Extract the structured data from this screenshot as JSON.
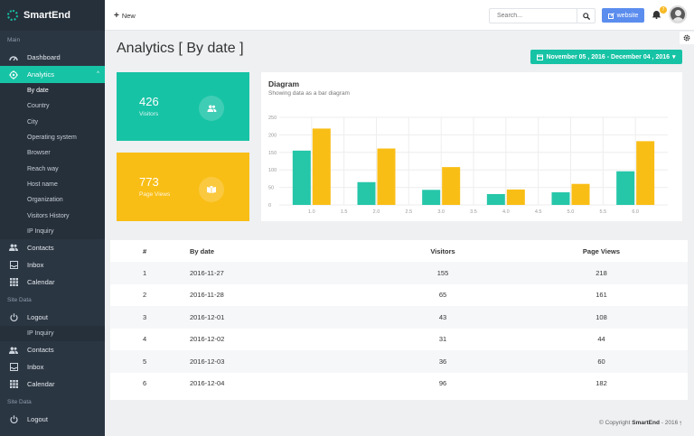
{
  "brand": {
    "name": "SmartEnd"
  },
  "sidebar": {
    "section_main": "Main",
    "dashboard": "Dashboard",
    "analytics": "Analytics",
    "sub_items": [
      "By date",
      "Country",
      "City",
      "Operating system",
      "Browser",
      "Reach way",
      "Host name",
      "Organization",
      "Visitors History",
      "IP Inquiry"
    ],
    "contacts": "Contacts",
    "inbox": "Inbox",
    "calendar": "Calendar",
    "section_site_data": "Site Data",
    "logout": "Logout",
    "ip_inquiry": "IP Inquiry",
    "contacts2": "Contacts",
    "inbox2": "Inbox",
    "calendar2": "Calendar",
    "section_site_data2": "Site Data",
    "logout2": "Logout"
  },
  "topbar": {
    "new_label": "New",
    "search_placeholder": "Search...",
    "website_label": "website",
    "notification_count": "7"
  },
  "page": {
    "title": "Analytics [ By date ]",
    "date_range": "November 05 , 2016 - December 04 , 2016"
  },
  "cards": {
    "visitors": {
      "value": "426",
      "label": "Visitors"
    },
    "page_views": {
      "value": "773",
      "label": "Page Views"
    }
  },
  "diagram": {
    "title": "Diagram",
    "subtitle": "Showing data as a bar diagram"
  },
  "chart_data": {
    "type": "bar",
    "title": "Diagram",
    "subtitle": "Showing data as a bar diagram",
    "y_ticks": [
      "250",
      "200",
      "150",
      "100",
      "50",
      "0"
    ],
    "x_ticks": [
      "1.0",
      "1.5",
      "2.0",
      "2.5",
      "3.0",
      "3.5",
      "4.0",
      "4.5",
      "5.0",
      "5.5",
      "6.0"
    ],
    "ylim": [
      0,
      250
    ],
    "xlim": [
      0.5,
      6.5
    ],
    "x": [
      1,
      2,
      3,
      4,
      5,
      6
    ],
    "series": [
      {
        "values": [
          155,
          65,
          43,
          31,
          36,
          96
        ],
        "color": "#26c6a9"
      },
      {
        "values": [
          218,
          161,
          108,
          44,
          60,
          182
        ],
        "color": "#f9be16"
      }
    ],
    "grid": true
  },
  "table": {
    "headers": [
      "#",
      "By date",
      "Visitors",
      "Page Views"
    ],
    "rows": [
      [
        "1",
        "2016-11-27",
        "155",
        "218"
      ],
      [
        "2",
        "2016-11-28",
        "65",
        "161"
      ],
      [
        "3",
        "2016-12-01",
        "43",
        "108"
      ],
      [
        "4",
        "2016-12-02",
        "31",
        "44"
      ],
      [
        "5",
        "2016-12-03",
        "36",
        "60"
      ],
      [
        "6",
        "2016-12-04",
        "96",
        "182"
      ]
    ]
  },
  "footer": {
    "copyright_prefix": "© Copyright",
    "brand": "SmartEnd",
    "year": "- 2016"
  },
  "colors": {
    "accent": "#17c3a5",
    "yellow": "#f9be16",
    "sidebar": "#2b3643",
    "website_button": "#5b8dee"
  },
  "icons": {
    "dashboard": "dashboard-gauge-icon",
    "analytics": "analytics-target-icon",
    "contacts": "people-icon",
    "inbox": "inbox-icon",
    "calendar": "calendar-grid-icon",
    "logout": "power-icon",
    "search": "search-icon",
    "bell": "bell-icon",
    "settings": "gear-icon"
  }
}
